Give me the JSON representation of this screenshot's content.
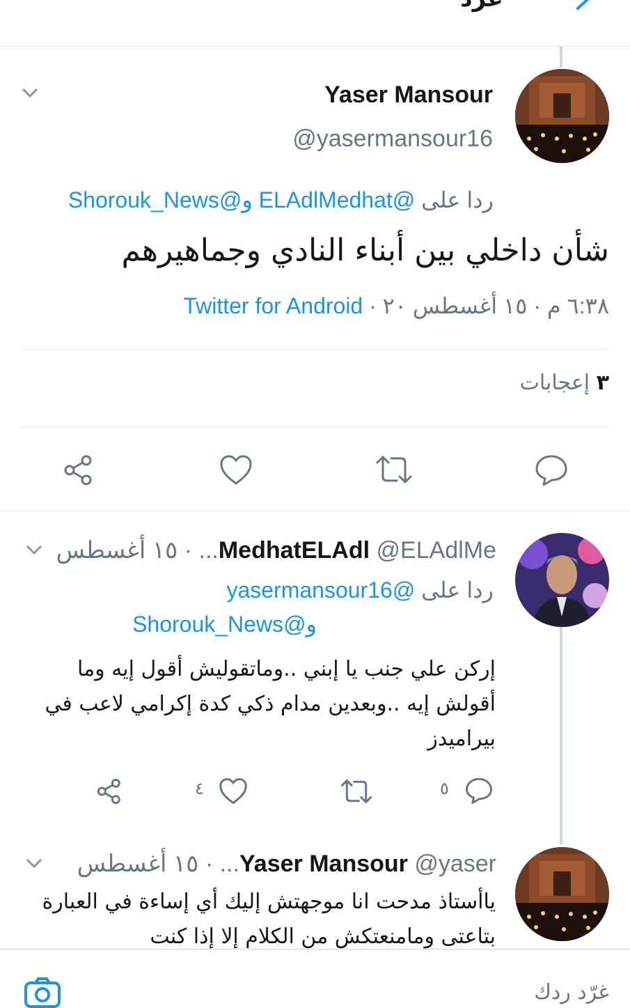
{
  "header": {
    "title": "غرّد"
  },
  "main_tweet": {
    "name": "Yaser Mansour",
    "handle": "@yasermansour16",
    "reply_prefix": "ردا على",
    "reply_targets": "@ELAdlMedhat و@Shorouk_News",
    "text": "شأن داخلي بين أبناء النادي وجماهيرهم",
    "meta": "٦:٣٨ م · ١٥ أغسطس ٢٠ ·",
    "source": "Twitter for Android",
    "likes_count": "٣",
    "likes_label": "إعجابات"
  },
  "reply1": {
    "name": "MedhatELAdl",
    "handle": "@ELAdlMe...",
    "date": "· ١٥ أغسطس",
    "reply_prefix": "ردا على",
    "reply_target1": "@yasermansour16",
    "reply_target2": "و@Shorouk_News",
    "text": "إركن علي جنب يا إبني ..وماتقوليش أقول إيه وما أقولش إيه ..وبعدين مدام ذكي كدة إكرامي لاعب في بيراميدز",
    "reply_count": "٥",
    "like_count": "٤"
  },
  "reply2": {
    "name": "Yaser Mansour",
    "handle": "@yaser...",
    "date": "· ١٥ أغسطس",
    "text": "ياأستاذ مدحت انا موجهتش إليك أي إساءة في العبارة بتاعتى ومامنعتكش من الكلام إلا إذا كنت"
  },
  "composer": {
    "placeholder": "غرّد ردك"
  },
  "colors": {
    "accent": "#1b95e0",
    "icon": "#657786",
    "divider": "#e1e8ed"
  }
}
